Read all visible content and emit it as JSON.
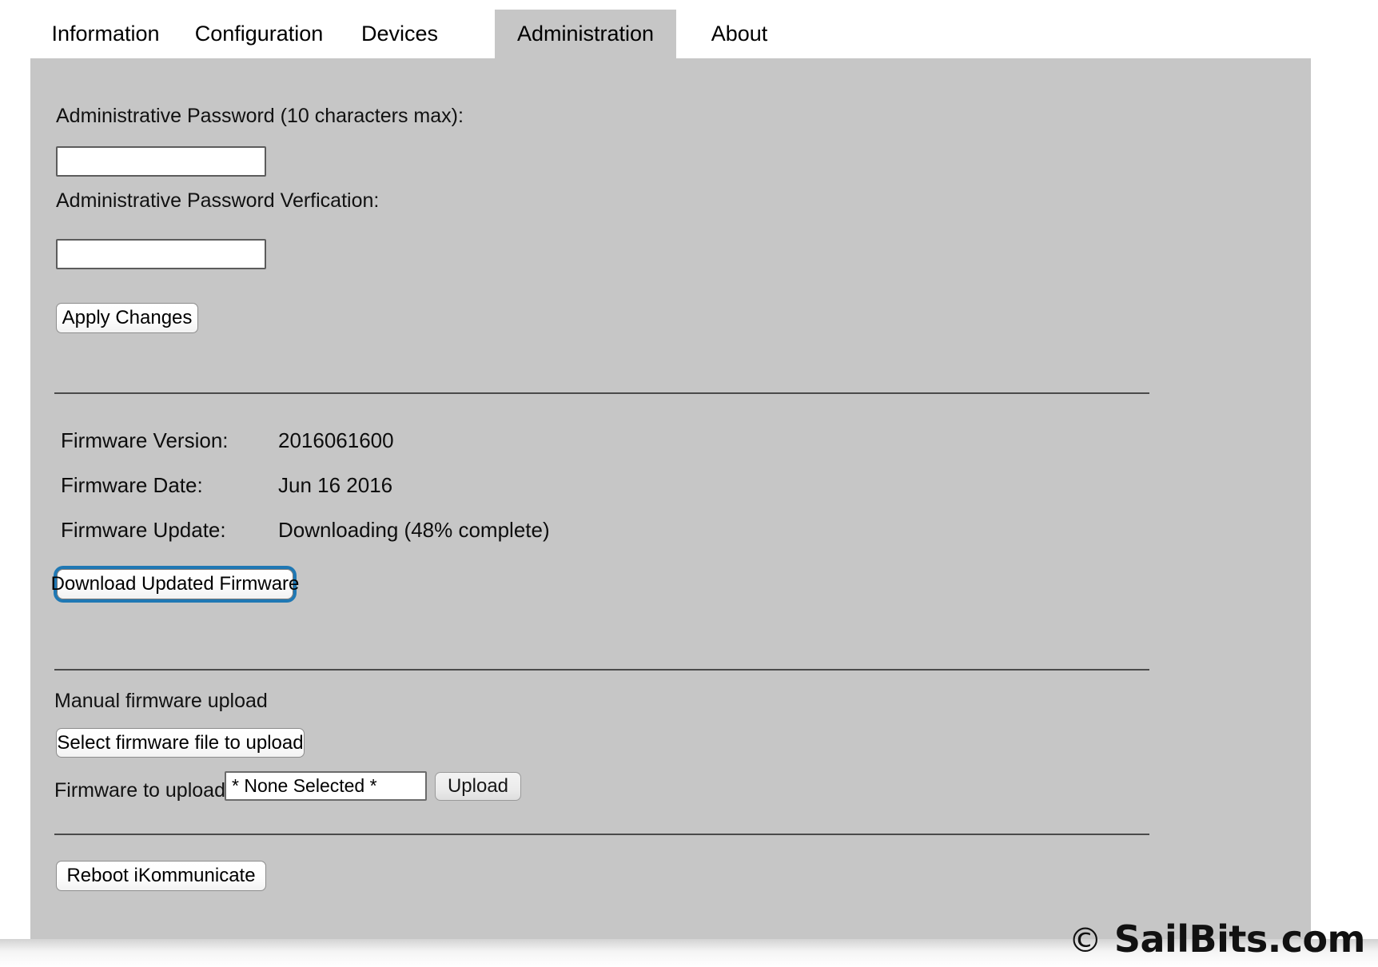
{
  "tabs": [
    {
      "label": "Information",
      "active": false
    },
    {
      "label": "Configuration",
      "active": false
    },
    {
      "label": "Devices",
      "active": false
    },
    {
      "label": "Administration",
      "active": true
    },
    {
      "label": "About",
      "active": false
    }
  ],
  "password_section": {
    "password_label": "Administrative Password (10 characters max):",
    "password_value": "",
    "password_placeholder": "",
    "verify_label": "Administrative Password Verfication:",
    "verify_value": "",
    "verify_placeholder": "",
    "apply_button": "Apply Changes"
  },
  "firmware_info": {
    "rows": [
      {
        "label": "Firmware Version:",
        "value": "2016061600"
      },
      {
        "label": "Firmware Date:",
        "value": "Jun 16 2016"
      },
      {
        "label": "Firmware Update:",
        "value": "Downloading (48% complete)"
      }
    ],
    "download_button": "Download Updated Firmware",
    "download_progress_percent": 48,
    "download_status": "Downloading"
  },
  "manual_upload": {
    "heading": "Manual firmware upload",
    "select_button": "Select firmware file to upload",
    "upload_label": "Firmware to upload:",
    "selected_file": "* None Selected *",
    "upload_button": "Upload"
  },
  "reboot": {
    "button": "Reboot iKommunicate"
  },
  "footer": {
    "copyright_symbol": "©",
    "text": "SailBits.com"
  },
  "colors": {
    "panel_background": "#c6c6c6",
    "page_background": "#ffffff",
    "focus_ring": "#1f78b4",
    "text": "#000000",
    "separator": "#4a4a4a"
  }
}
